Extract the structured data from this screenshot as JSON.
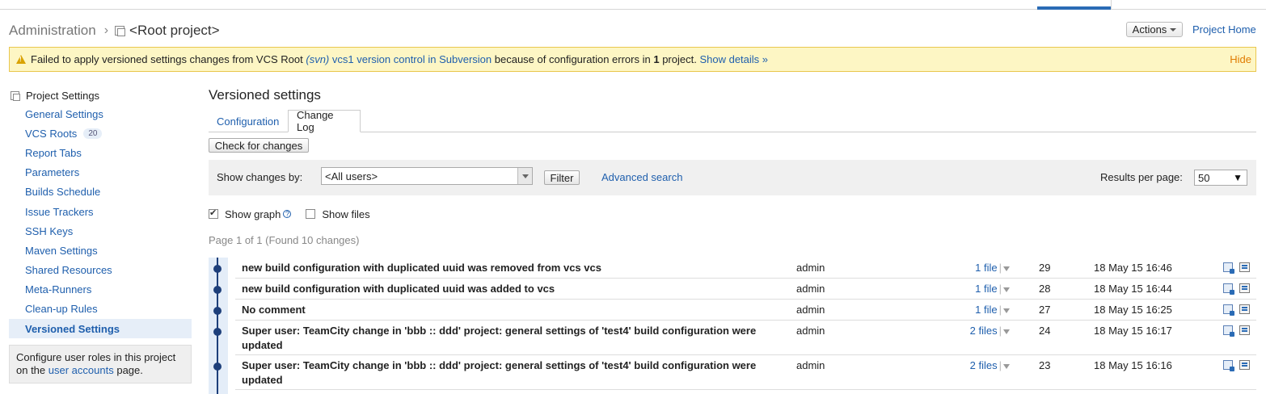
{
  "header": {
    "breadcrumb_admin": "Administration",
    "breadcrumb_project": "<Root project>",
    "actions_label": "Actions",
    "project_home": "Project Home"
  },
  "warning": {
    "prefix": "Failed to apply versioned settings changes from VCS Root",
    "vcs_type": "(svn)",
    "vcs_name": "vcs1 version control in Subversion",
    "middle": "because of configuration errors in",
    "count": "1",
    "suffix": "project.",
    "details_link": "Show details »",
    "hide_link": "Hide"
  },
  "sidebar": {
    "header": "Project Settings",
    "items": [
      {
        "label": "General Settings",
        "badge": ""
      },
      {
        "label": "VCS Roots",
        "badge": "20"
      },
      {
        "label": "Report Tabs",
        "badge": ""
      },
      {
        "label": "Parameters",
        "badge": ""
      },
      {
        "label": "Builds Schedule",
        "badge": ""
      },
      {
        "label": "Issue Trackers",
        "badge": ""
      },
      {
        "label": "SSH Keys",
        "badge": ""
      },
      {
        "label": "Maven Settings",
        "badge": ""
      },
      {
        "label": "Shared Resources",
        "badge": ""
      },
      {
        "label": "Meta-Runners",
        "badge": ""
      },
      {
        "label": "Clean-up Rules",
        "badge": ""
      },
      {
        "label": "Versioned Settings",
        "badge": ""
      }
    ],
    "note_text": "Configure user roles in this project on the",
    "note_link": "user accounts",
    "note_suffix": "page."
  },
  "main": {
    "title": "Versioned settings",
    "tabs": [
      {
        "label": "Configuration"
      },
      {
        "label": "Change Log"
      }
    ],
    "check_button": "Check for changes",
    "filter": {
      "show_by_label": "Show changes by:",
      "users_value": "<All users>",
      "filter_button": "Filter",
      "advanced_search": "Advanced search",
      "results_label": "Results per page:",
      "results_value": "50"
    },
    "options": {
      "show_graph": "Show graph",
      "show_files": "Show files"
    },
    "page_info": "Page 1 of 1 (Found 10 changes)"
  },
  "changes": [
    {
      "desc": "new build configuration with duplicated uuid was removed from vcs vcs",
      "user": "admin",
      "files": "1 file",
      "num": "29",
      "date": "18 May 15 16:46"
    },
    {
      "desc": "new build configuration with duplicated uuid was added to vcs",
      "user": "admin",
      "files": "1 file",
      "num": "28",
      "date": "18 May 15 16:44"
    },
    {
      "desc": "No comment",
      "user": "admin",
      "files": "1 file",
      "num": "27",
      "date": "18 May 15 16:25"
    },
    {
      "desc": "Super user: TeamCity change in 'bbb :: ddd' project: general settings of 'test4' build configuration were updated",
      "user": "admin",
      "files": "2 files",
      "num": "24",
      "date": "18 May 15 16:17"
    },
    {
      "desc": "Super user: TeamCity change in 'bbb :: ddd' project: general settings of 'test4' build configuration were updated",
      "user": "admin",
      "files": "2 files",
      "num": "23",
      "date": "18 May 15 16:16"
    }
  ]
}
